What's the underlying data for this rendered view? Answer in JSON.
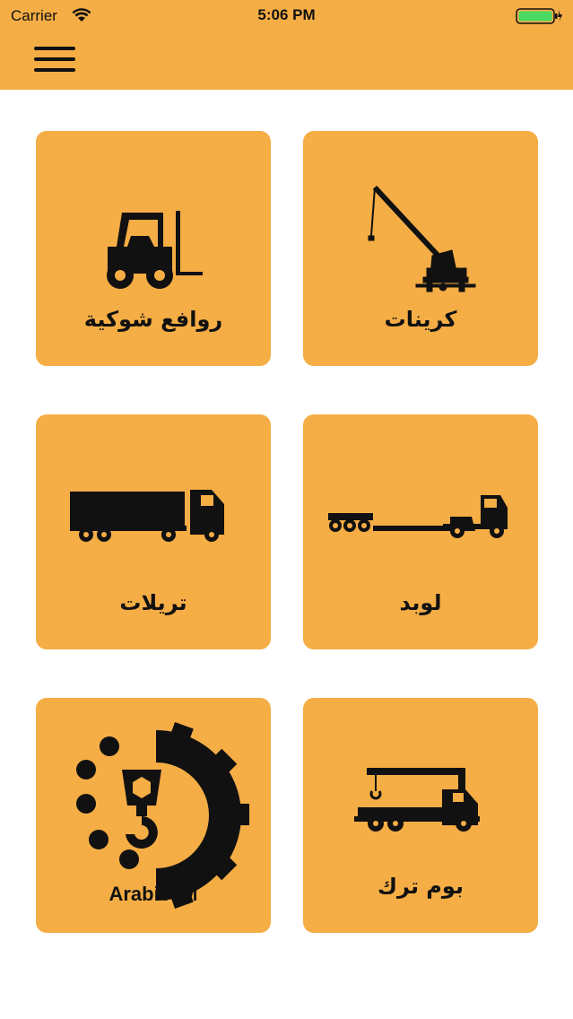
{
  "status_bar": {
    "carrier": "Carrier",
    "time": "5:06 PM",
    "battery_color": "#4cd964"
  },
  "nav": {
    "menu_icon": "hamburger-menu-icon",
    "background": "#f5ad45"
  },
  "tiles": [
    {
      "label": "كرينات",
      "icon": "crane-icon"
    },
    {
      "label": "روافع شوكية",
      "icon": "forklift-icon"
    },
    {
      "label": "لوبد",
      "icon": "lowbed-trailer-icon"
    },
    {
      "label": "تريلات",
      "icon": "semi-truck-icon"
    },
    {
      "label": "بوم ترك",
      "icon": "boom-truck-icon"
    },
    {
      "label": "",
      "icon": "arabic-m-logo",
      "logo_text": "Arabic. M"
    }
  ],
  "colors": {
    "tile": "#f5ad45",
    "icon": "#111111",
    "background": "#ffffff"
  }
}
